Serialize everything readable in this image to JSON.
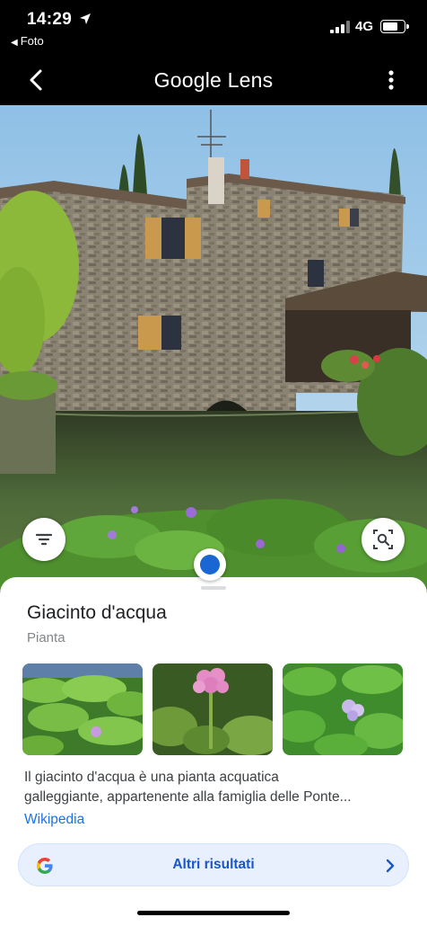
{
  "status_bar": {
    "time": "14:29",
    "back_app": "Foto",
    "network": "4G",
    "location_icon": "location-arrow-icon",
    "signal_icon": "cellular-signal-icon",
    "battery_icon": "battery-icon"
  },
  "app_bar": {
    "title_brand": "Google",
    "title_product": " Lens",
    "back_icon": "back-chevron-icon",
    "menu_icon": "more-vert-icon"
  },
  "overlay_buttons": {
    "filter_icon": "filter-list-icon",
    "search_icon": "image-search-icon"
  },
  "result": {
    "name": "Giacinto d'acqua",
    "category": "Pianta",
    "thumbnails": [
      {
        "subject": "water-hyacinth-leaves"
      },
      {
        "subject": "water-hyacinth-flower-pink"
      },
      {
        "subject": "water-hyacinth-flower-lilac"
      }
    ],
    "description_line1": "Il giacinto d'acqua è una pianta acquatica",
    "description_line2": "galleggiante, appartenente alla famiglia delle Ponte...",
    "source_link": "Wikipedia",
    "more_results_label": "Altri risultati",
    "google_icon": "google-g-icon",
    "chevron_icon": "chevron-right-icon"
  },
  "colors": {
    "accent_blue": "#1a73e8",
    "marker_blue": "#1a66d2",
    "button_bg": "#e8f0fe",
    "button_text": "#1a57c4"
  }
}
